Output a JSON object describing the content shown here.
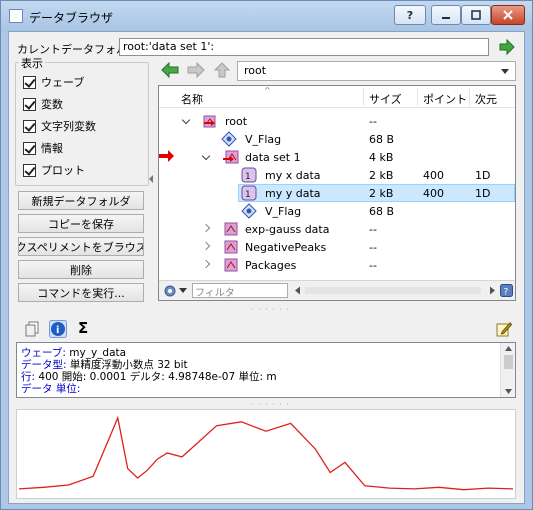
{
  "window": {
    "title": "データブラウザ",
    "help_label": "?"
  },
  "current_folder": {
    "label": "カレントデータフォルダ:",
    "value": "root:'data set 1':"
  },
  "display": {
    "legend": "表示",
    "items": [
      {
        "label": "ウェーブ",
        "checked": true
      },
      {
        "label": "変数",
        "checked": true
      },
      {
        "label": "文字列変数",
        "checked": true
      },
      {
        "label": "情報",
        "checked": true
      },
      {
        "label": "プロット",
        "checked": true
      }
    ]
  },
  "side_buttons": [
    "新規データフォルダ",
    "コピーを保存",
    "エクスペリメントをブラウズ...",
    "削除",
    "コマンドを実行..."
  ],
  "nav": {
    "path_value": "root"
  },
  "tree": {
    "columns": [
      "名称",
      "サイズ",
      "ポイント",
      "次元"
    ],
    "rows": [
      {
        "name": "root",
        "size": "--",
        "points": "",
        "dims": ""
      },
      {
        "name": "V_Flag",
        "size": "68 B",
        "points": "",
        "dims": ""
      },
      {
        "name": "data set 1",
        "size": "4 kB",
        "points": "",
        "dims": ""
      },
      {
        "name": "my x data",
        "size": "2 kB",
        "points": "400",
        "dims": "1D"
      },
      {
        "name": "my y data",
        "size": "2 kB",
        "points": "400",
        "dims": "1D"
      },
      {
        "name": "V_Flag",
        "size": "68 B",
        "points": "",
        "dims": ""
      },
      {
        "name": "exp-gauss data",
        "size": "--",
        "points": "",
        "dims": ""
      },
      {
        "name": "NegativePeaks",
        "size": "--",
        "points": "",
        "dims": ""
      },
      {
        "name": "Packages",
        "size": "--",
        "points": "",
        "dims": ""
      }
    ],
    "filter_placeholder": "フィルタ"
  },
  "info": {
    "sigma": "Σ",
    "lines": [
      {
        "key": "ウェーブ:",
        "text": " my_y_data"
      },
      {
        "key": "データ型:",
        "text": " 単精度浮動小数点 32 bit"
      },
      {
        "key": "行:",
        "text": " 400   開始: 0.0001   デルタ: 4.98748e-07   単位: m"
      },
      {
        "key": "データ 単位:",
        "text": ""
      }
    ]
  },
  "colors": {
    "plot_line": "#e02020",
    "selection": "#cce8ff",
    "marker_arrow": "#e00000"
  },
  "chart_data": {
    "type": "line",
    "x": [
      0,
      5,
      10,
      15,
      20,
      22,
      24,
      26,
      28,
      30,
      33,
      36,
      40,
      45,
      50,
      55,
      60,
      63,
      66,
      70,
      75,
      80,
      85,
      90,
      95,
      100
    ],
    "y": [
      0.04,
      0.06,
      0.09,
      0.2,
      0.95,
      0.3,
      0.18,
      0.28,
      0.42,
      0.5,
      0.45,
      0.62,
      0.85,
      0.9,
      0.78,
      0.88,
      0.55,
      0.25,
      0.38,
      0.08,
      0.05,
      0.04,
      0.06,
      0.03,
      0.05,
      0.04
    ],
    "series": [
      {
        "name": "",
        "color": "#e02020"
      }
    ]
  }
}
